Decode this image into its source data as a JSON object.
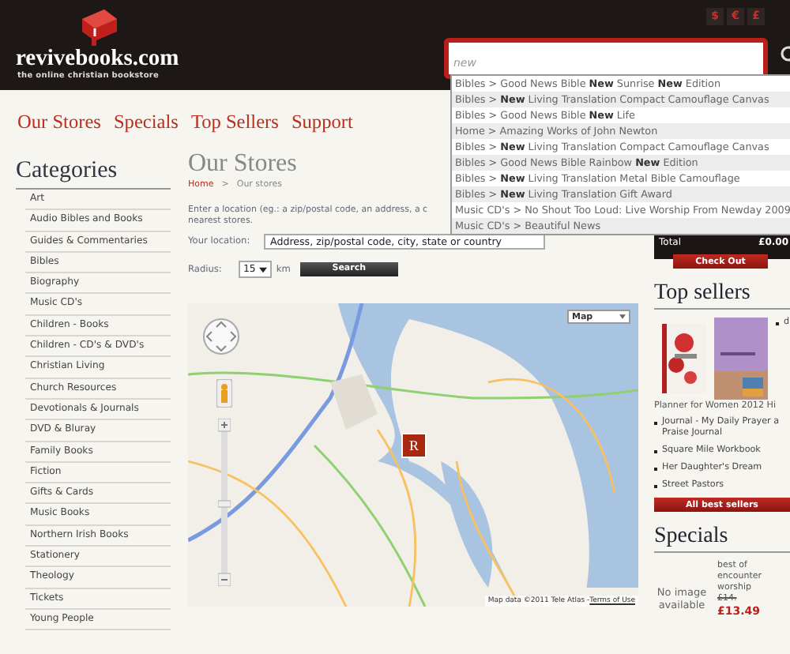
{
  "header": {
    "logo": "revivebooks.com",
    "tagline": "the online christian bookstore",
    "currencies": [
      "$",
      "€",
      "£"
    ],
    "search": {
      "value": "new"
    }
  },
  "suggestions": [
    "Bibles > Good News Bible **New** Sunrise **New** Edition",
    "Bibles > **New** Living Translation Compact Camouflage Canvas",
    "Bibles > Good News Bible **New** Life",
    "Home > Amazing Works of John Newton",
    "Bibles > **New** Living Translation Compact Camouflage Canvas",
    "Bibles > Good News Bible Rainbow **New** Edition",
    "Bibles > **New** Living Translation Metal Bible Camouflage",
    "Bibles > **New** Living Translation Gift Award",
    "Music CD's > No Shout Too Loud: Live Worship From Newday 2009",
    "Music CD's > Beautiful News"
  ],
  "nav": [
    "Our Stores",
    "Specials",
    "Top Sellers",
    "Support"
  ],
  "sidebar": {
    "title": "Categories",
    "items": [
      "Art",
      "Audio Bibles and Books",
      "Guides & Commentaries",
      "Bibles",
      "Biography",
      "Music CD's",
      "Children - Books",
      "Children - CD's & DVD's",
      "Christian Living",
      "Church Resources",
      "Devotionals & Journals",
      "DVD & Bluray",
      "Family Books",
      "Fiction",
      "Gifts & Cards",
      "Music Books",
      "Northern Irish Books",
      "Stationery",
      "Theology",
      "Tickets",
      "Young People"
    ]
  },
  "main": {
    "title": "Our Stores",
    "breadcrumb": [
      "Home",
      ">",
      "Our stores"
    ],
    "intro": [
      "Enter a location (eg.: a zip/postal code, an address, a c",
      "nearest stores."
    ],
    "location": {
      "label": "Your location:",
      "placeholder": "Address, zip/postal code, city, state or country"
    },
    "radius": {
      "label": "Radius:",
      "value": "15",
      "unit": "km"
    },
    "search_button": "Search",
    "map": {
      "type_control": "Map",
      "marker_label": "R",
      "attribution": "Map data ©2011 Tele Atlas - ",
      "terms": "Terms of Use"
    }
  },
  "cart": {
    "total_label": "Total",
    "total": "£0.00",
    "checkout": "Check Out"
  },
  "top_sellers": {
    "title": "Top sellers",
    "side_item": "d",
    "caption": "Planner for Women 2012 Hi",
    "items": [
      {
        "lines": [
          "Journal - My Daily Prayer a",
          "Praise Journal"
        ]
      },
      {
        "lines": [
          "Square Mile Workbook"
        ]
      },
      {
        "lines": [
          "Her Daughter's Dream"
        ]
      },
      {
        "lines": [
          "Street Pastors"
        ]
      }
    ],
    "button": "All best sellers"
  },
  "specials": {
    "title": "Specials",
    "no_image": "No image available",
    "name": "best of encounter worship",
    "old_price": "£14.",
    "price": "£13.49"
  }
}
